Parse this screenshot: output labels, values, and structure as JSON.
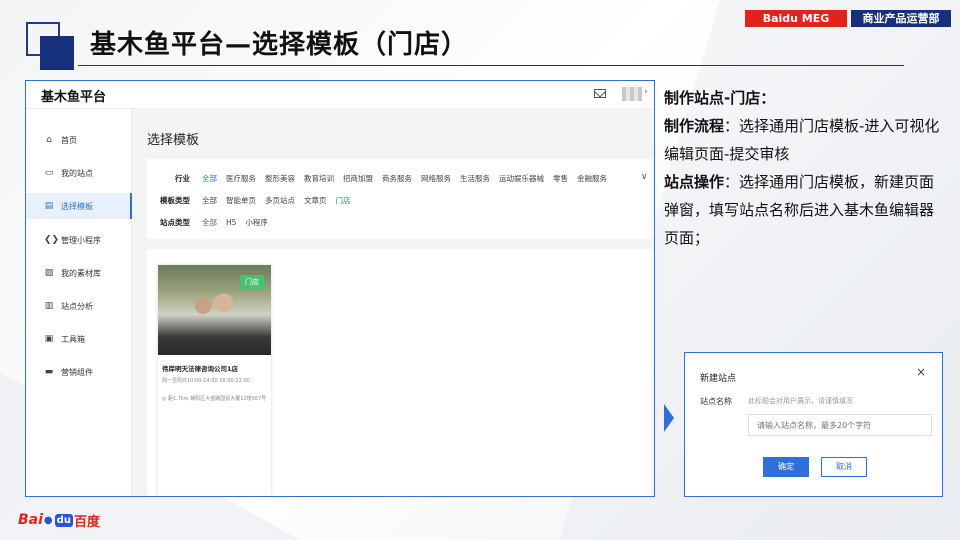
{
  "slide": {
    "title": "基木鱼平台—选择模板（门店）",
    "brand": "Baidu MEG",
    "department": "商业产品运营部",
    "footer_logo": {
      "latin": "Bai",
      "du": "du",
      "chinese": "百度"
    }
  },
  "app": {
    "name": "基木鱼平台",
    "header_icons": [
      "mail-icon",
      "avatar"
    ],
    "sidebar": [
      {
        "label": "首页",
        "icon": "home-icon",
        "glyph": "⌂"
      },
      {
        "label": "我的站点",
        "icon": "site-icon",
        "glyph": "▭"
      },
      {
        "label": "选择模板",
        "icon": "template-icon",
        "glyph": "▤",
        "active": true
      },
      {
        "label": "管理小程序",
        "icon": "mini-program-icon",
        "glyph": "❮❯"
      },
      {
        "label": "我的素材库",
        "icon": "image-icon",
        "glyph": "▨"
      },
      {
        "label": "站点分析",
        "icon": "chart-icon",
        "glyph": "▥"
      },
      {
        "label": "工具箱",
        "icon": "toolbox-icon",
        "glyph": "▣"
      },
      {
        "label": "营销组件",
        "icon": "component-icon",
        "glyph": "▬"
      }
    ],
    "content_title": "选择模板",
    "filters": [
      {
        "label": "行业",
        "options": [
          "全部",
          "医疗服务",
          "整形美容",
          "教育培训",
          "招商加盟",
          "商务服务",
          "网络服务",
          "生活服务",
          "运动娱乐器械",
          "零售",
          "金融服务"
        ],
        "selected": "全部"
      },
      {
        "label": "模板类型",
        "options": [
          "全部",
          "智能单页",
          "多页站点",
          "文章页",
          "门店"
        ],
        "selected": "门店"
      },
      {
        "label": "站点类型",
        "options": [
          "全部",
          "H5",
          "小程序"
        ],
        "selected": "全部"
      }
    ],
    "template_card": {
      "badge": "门店",
      "name": "伟岸明天法律咨询公司1店",
      "hours": "周一至周日10:00-14:00 16:00-22:00",
      "address": "◎ 距1.7km 朝阳区大望路国贸大厦12楼567号"
    }
  },
  "description": {
    "heading": "制作站点-门店：",
    "flow_label": "制作流程",
    "flow_text": "：选择通用门店模板-进入可视化编辑页面-提交审核",
    "op_label": "站点操作",
    "op_text": "：选择通用门店模板，新建页面弹窗，填写站点名称后进入基木鱼编辑器页面；"
  },
  "dialog": {
    "title": "新建站点",
    "close": "×",
    "field_label": "站点名称",
    "hint": "此标题会对用户展示，请谨慎填写",
    "placeholder": "请输入站点名称，最多20个字符",
    "confirm": "确定",
    "cancel": "取消"
  },
  "colors": {
    "accent": "#2f6fdc",
    "brand_red": "#e2231a",
    "navy": "#16307a",
    "badge_green": "#46c36f"
  }
}
